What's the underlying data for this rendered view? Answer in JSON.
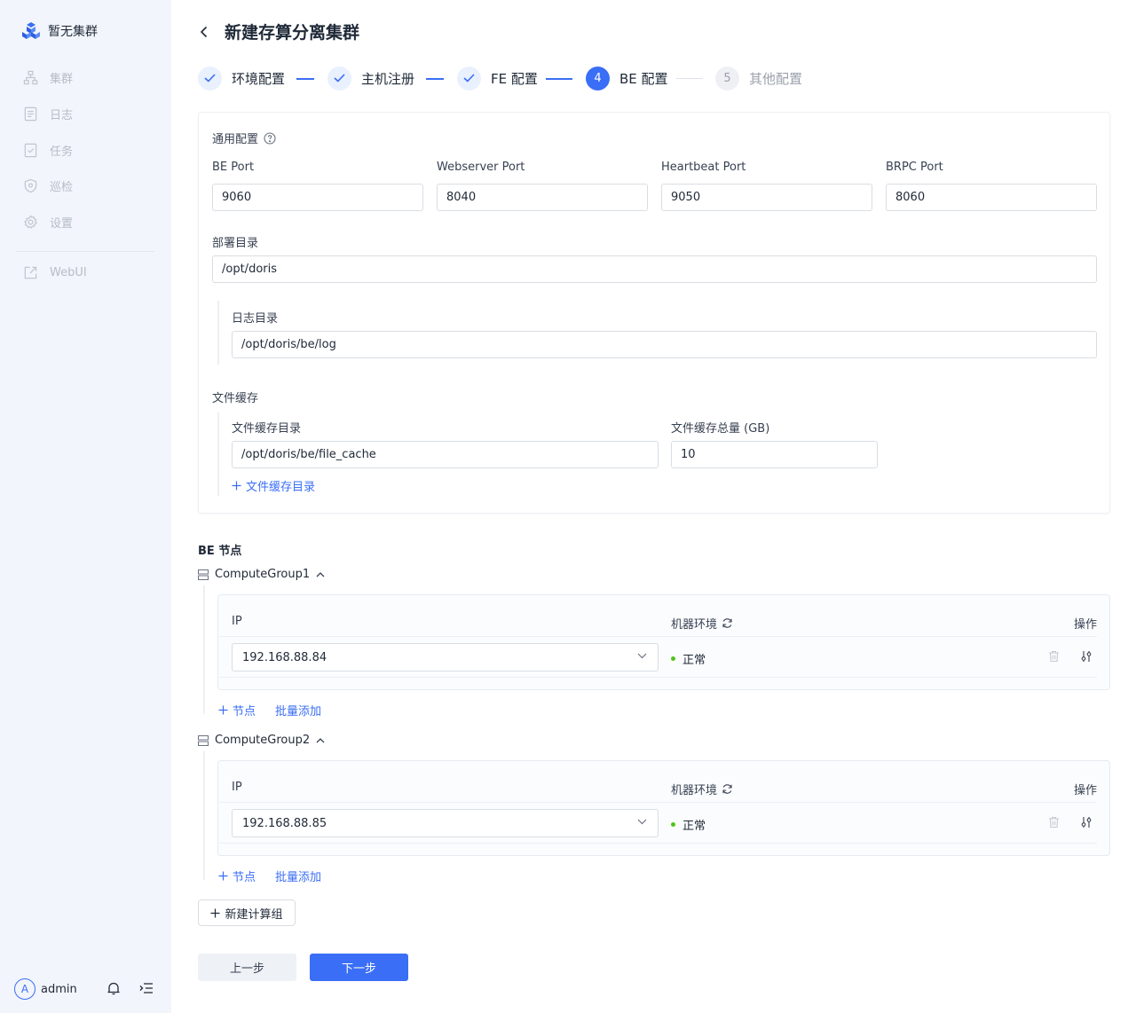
{
  "sidebar": {
    "brand": "暂无集群",
    "items": [
      {
        "label": "集群",
        "icon": "cluster-icon"
      },
      {
        "label": "日志",
        "icon": "log-icon"
      },
      {
        "label": "任务",
        "icon": "task-icon"
      },
      {
        "label": "巡检",
        "icon": "inspection-icon"
      },
      {
        "label": "设置",
        "icon": "gear-icon"
      }
    ],
    "webui": "WebUI",
    "user": {
      "avatar": "A",
      "name": "admin"
    }
  },
  "header": {
    "title": "新建存算分离集群"
  },
  "steps": [
    {
      "label": "环境配置",
      "status": "done"
    },
    {
      "label": "主机注册",
      "status": "done"
    },
    {
      "label": "FE 配置",
      "status": "done"
    },
    {
      "label": "BE 配置",
      "status": "active",
      "number": "4"
    },
    {
      "label": "其他配置",
      "status": "wait",
      "number": "5"
    }
  ],
  "general": {
    "title": "通用配置",
    "fields": [
      {
        "label": "BE Port",
        "value": "9060"
      },
      {
        "label": "Webserver Port",
        "value": "8040"
      },
      {
        "label": "Heartbeat Port",
        "value": "9050"
      },
      {
        "label": "BRPC Port",
        "value": "8060"
      }
    ],
    "deploy_dir": {
      "label": "部署目录",
      "value": "/opt/doris"
    },
    "log_dir": {
      "label": "日志目录",
      "value": "/opt/doris/be/log"
    },
    "file_cache": {
      "title": "文件缓存",
      "dir_label": "文件缓存目录",
      "dir_value": "/opt/doris/be/file_cache",
      "size_label": "文件缓存总量 (GB)",
      "size_value": "10",
      "add_label": "文件缓存目录"
    }
  },
  "be_nodes": {
    "title": "BE 节点",
    "columns": {
      "ip": "IP",
      "env": "机器环境",
      "ops": "操作"
    },
    "groups": [
      {
        "name": "ComputeGroup1",
        "ip": "192.168.88.84",
        "status": "正常"
      },
      {
        "name": "ComputeGroup2",
        "ip": "192.168.88.85",
        "status": "正常"
      }
    ],
    "add_node": "节点",
    "batch_add": "批量添加",
    "new_group": "新建计算组"
  },
  "footer": {
    "prev": "上一步",
    "next": "下一步"
  },
  "colors": {
    "primary": "#3a6ef6",
    "success": "#52c41a",
    "sidebar_bg": "#f2f5fb"
  }
}
